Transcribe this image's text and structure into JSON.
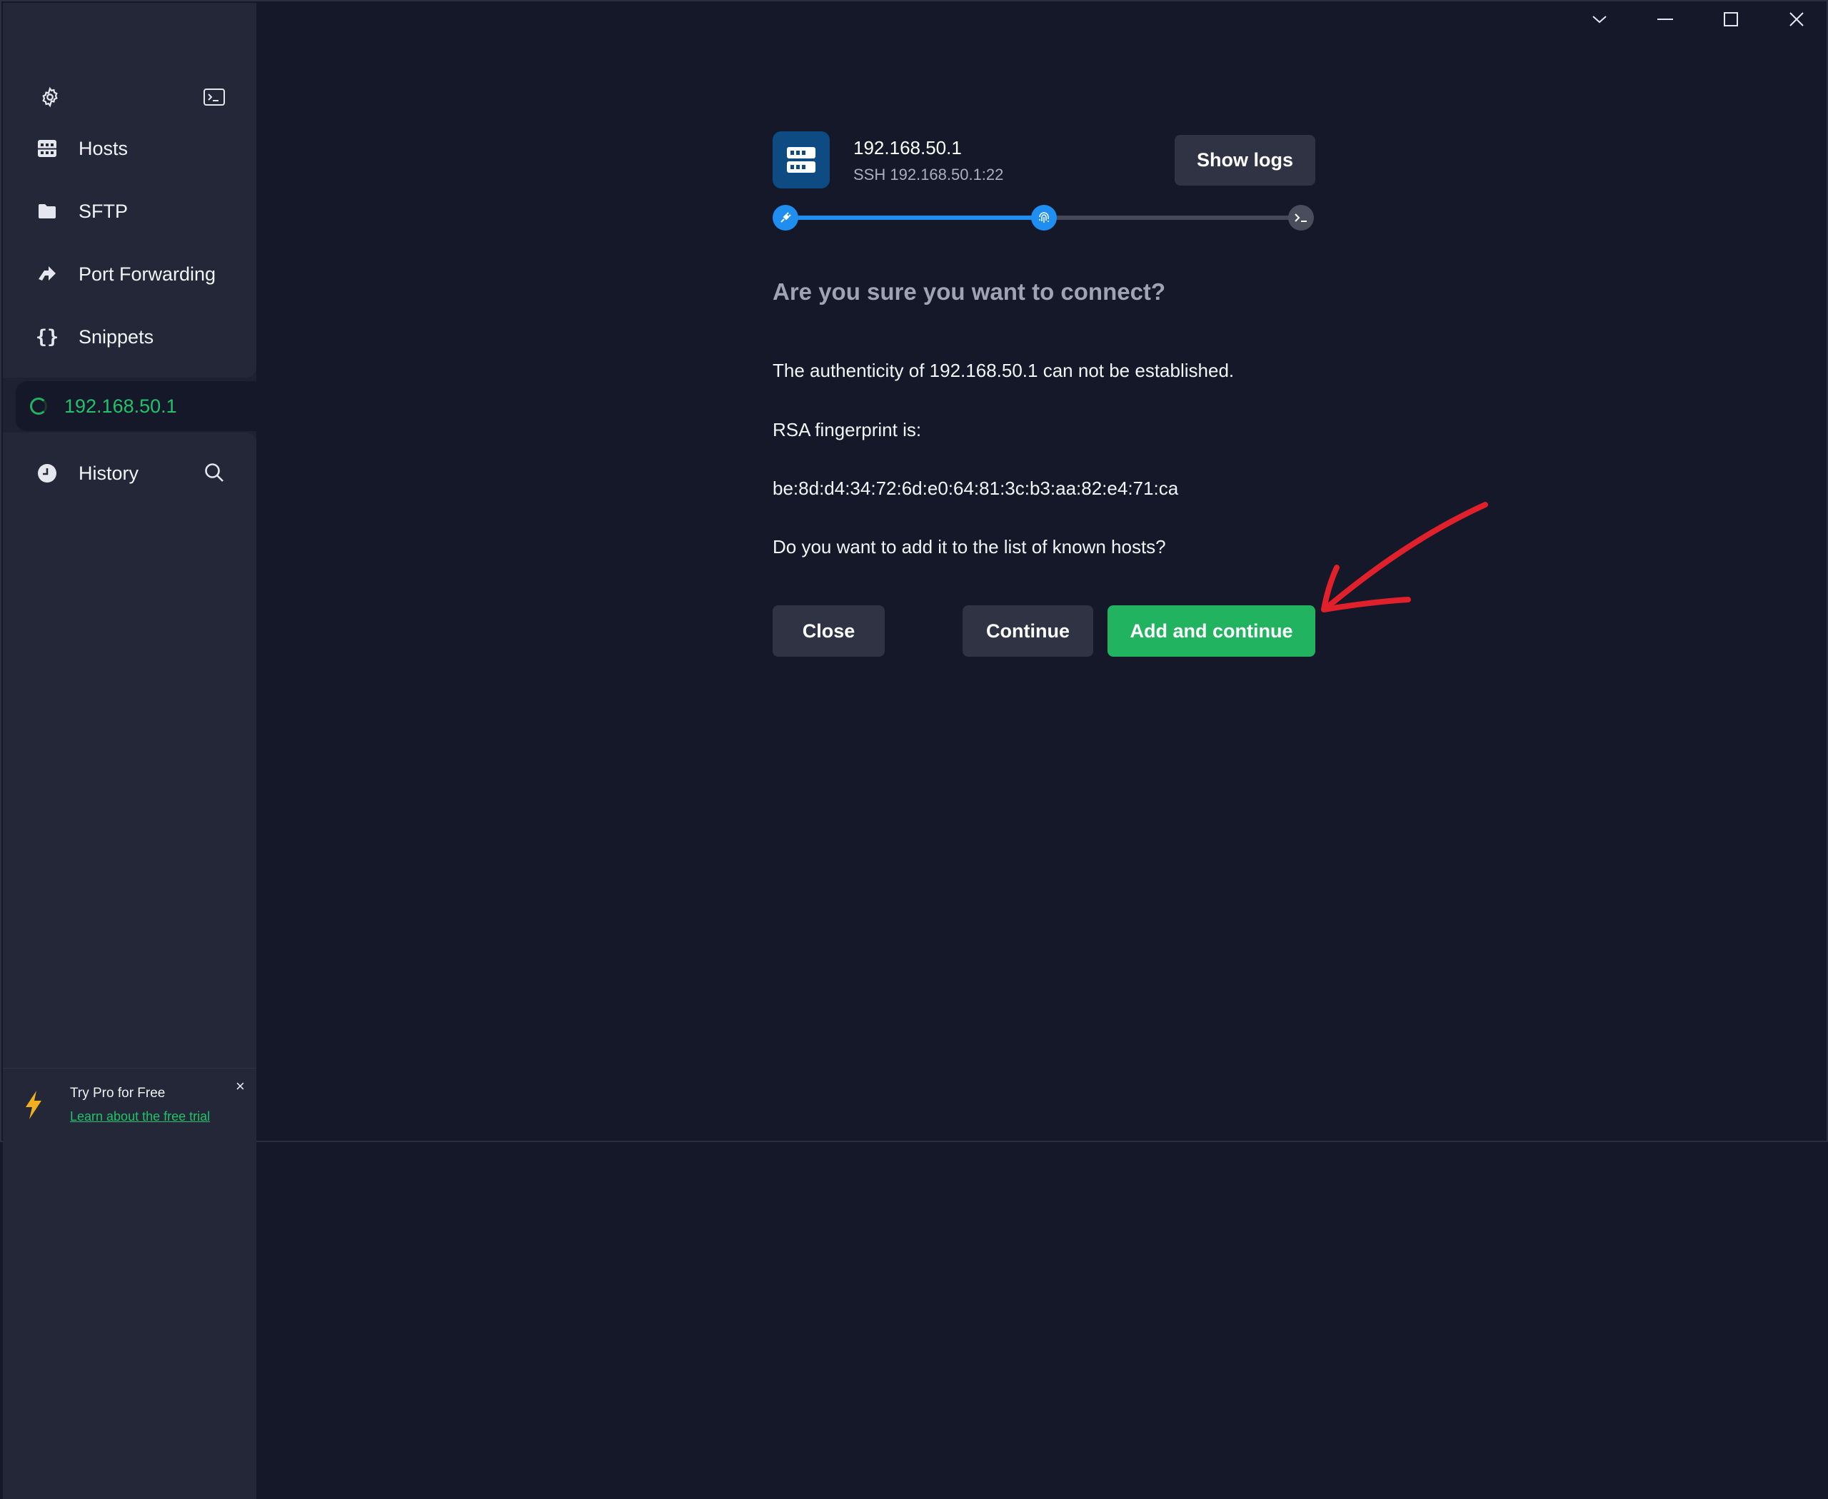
{
  "sidebar": {
    "top_icons": {
      "settings": "gear-icon",
      "terminal": "terminal-icon"
    },
    "nav": [
      {
        "label": "Hosts",
        "icon": "hosts-grid-icon"
      },
      {
        "label": "SFTP",
        "icon": "folder-icon"
      },
      {
        "label": "Port Forwarding",
        "icon": "port-forward-icon"
      },
      {
        "label": "Snippets",
        "icon": "braces-icon"
      }
    ],
    "active_host": {
      "label": "192.168.50.1",
      "icon": "spinner-icon"
    },
    "history": {
      "label": "History",
      "icon": "clock-icon",
      "search_icon": "search-icon"
    },
    "promo": {
      "title": "Try Pro for Free",
      "link": "Learn about the free trial",
      "close": "×"
    }
  },
  "connection": {
    "host_name": "192.168.50.1",
    "host_sub": "SSH 192.168.50.1:22",
    "show_logs_label": "Show logs",
    "progress_step": 2,
    "progress_steps_total": 3,
    "heading": "Are you sure you want to connect?",
    "authenticity": "The authenticity of 192.168.50.1 can not be established.",
    "fingerprint_label": "RSA fingerprint is:",
    "fingerprint": "be:8d:d4:34:72:6d:e0:64:81:3c:b3:aa:82:e4:71:ca",
    "question": "Do you want to add it to the list of known hosts?",
    "buttons": {
      "close": "Close",
      "continue": "Continue",
      "add_continue": "Add and continue"
    }
  },
  "colors": {
    "background": "#141828",
    "sidebar": "#232737",
    "accent_blue": "#1f8ef0",
    "accent_green": "#21b35f",
    "annotation_red": "#e0202a"
  }
}
